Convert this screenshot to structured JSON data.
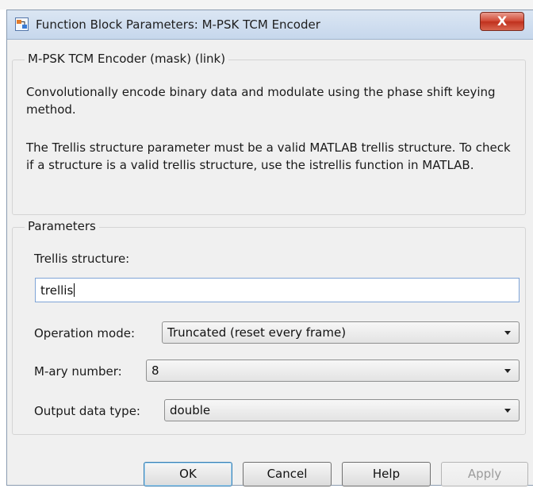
{
  "window": {
    "title": "Function Block Parameters: M-PSK TCM Encoder",
    "close_glyph": "X"
  },
  "mask_group": {
    "legend": "M-PSK TCM Encoder (mask) (link)",
    "description_1": "Convolutionally encode binary data and modulate using the phase shift keying method.",
    "description_2": "The Trellis structure parameter must be a valid MATLAB trellis structure. To check if a structure is a valid trellis structure, use the istrellis function in MATLAB."
  },
  "parameters_group": {
    "legend": "Parameters",
    "trellis_label": "Trellis structure:",
    "trellis_value": "trellis",
    "operation_mode_label": "Operation mode:",
    "operation_mode_value": "Truncated (reset every frame)",
    "mary_label": "M-ary number:",
    "mary_value": "8",
    "output_type_label": "Output data type:",
    "output_type_value": "double"
  },
  "buttons": {
    "ok": "OK",
    "cancel": "Cancel",
    "help": "Help",
    "apply": "Apply"
  },
  "icons": {
    "app": "simulink-block-icon",
    "close": "close-icon",
    "dropdown": "chevron-down-icon"
  },
  "colors": {
    "titlebar": "#c6d7ec",
    "close_button": "#c0311d",
    "default_button_border": "#3c7fb1",
    "panel": "#f0f0f0"
  }
}
